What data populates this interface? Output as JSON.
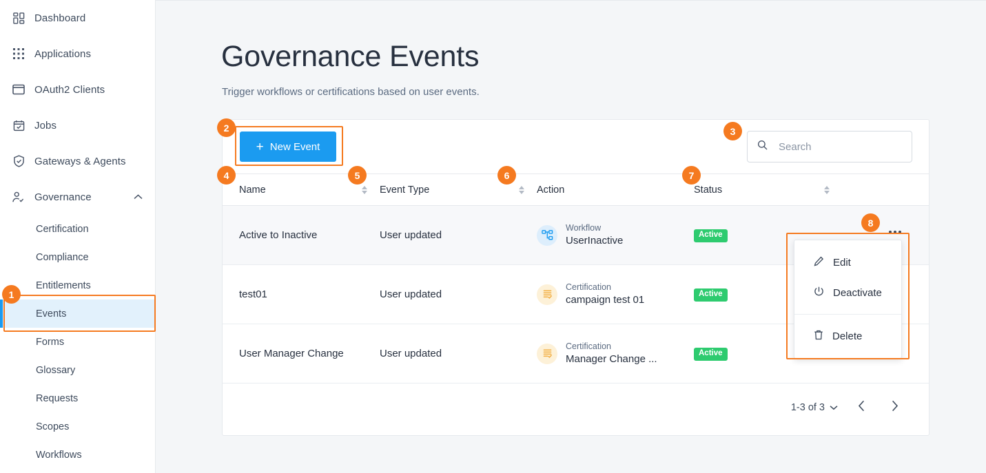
{
  "sidebar": {
    "items": [
      {
        "label": "Dashboard",
        "icon": "dashboard-icon"
      },
      {
        "label": "Applications",
        "icon": "applications-grid-icon"
      },
      {
        "label": "OAuth2 Clients",
        "icon": "window-icon"
      },
      {
        "label": "Jobs",
        "icon": "calendar-check-icon"
      },
      {
        "label": "Gateways & Agents",
        "icon": "shield-check-icon"
      },
      {
        "label": "Governance",
        "icon": "user-check-icon",
        "expanded": true,
        "caret": "chevron-up-icon"
      }
    ],
    "sub_items": [
      {
        "label": "Certification",
        "active": false
      },
      {
        "label": "Compliance",
        "active": false
      },
      {
        "label": "Entitlements",
        "active": false
      },
      {
        "label": "Events",
        "active": true
      },
      {
        "label": "Forms",
        "active": false
      },
      {
        "label": "Glossary",
        "active": false
      },
      {
        "label": "Requests",
        "active": false
      },
      {
        "label": "Scopes",
        "active": false
      },
      {
        "label": "Workflows",
        "active": false
      }
    ],
    "active_accent_color": "#1b9bf0",
    "active_bg_color": "#e2f1fc"
  },
  "header": {
    "title": "Governance Events",
    "subtitle": "Trigger workflows or certifications based on user events."
  },
  "toolbar": {
    "new_event_label": "New Event",
    "new_event_plus": "+",
    "new_event_color": "#1b9bf0",
    "search_placeholder": "Search",
    "search_value": ""
  },
  "table": {
    "columns": [
      {
        "label": "Name",
        "sortable": true
      },
      {
        "label": "Event Type",
        "sortable": true
      },
      {
        "label": "Action",
        "sortable": false
      },
      {
        "label": "Status",
        "sortable": true
      }
    ],
    "rows": [
      {
        "name": "Active to Inactive",
        "event_type": "User updated",
        "action_kind": "Workflow",
        "action_name": "UserInactive",
        "action_icon": "workflow-icon",
        "status": "Active"
      },
      {
        "name": "test01",
        "event_type": "User updated",
        "action_kind": "Certification",
        "action_name": "campaign test 01",
        "action_icon": "certification-icon",
        "status": "Active"
      },
      {
        "name": "User Manager Change",
        "event_type": "User updated",
        "action_kind": "Certification",
        "action_name": "Manager Change ...",
        "action_icon": "certification-icon",
        "status": "Active"
      }
    ],
    "status_color": "#2ecb6f"
  },
  "pagination": {
    "range_label": "1-3 of 3",
    "prev_icon": "chevron-left-icon",
    "next_icon": "chevron-right-icon",
    "dropdown_icon": "chevron-down-icon"
  },
  "row_menu": {
    "items": [
      {
        "label": "Edit",
        "icon": "pencil-icon"
      },
      {
        "label": "Deactivate",
        "icon": "power-icon"
      },
      {
        "label": "Delete",
        "icon": "trash-icon"
      }
    ]
  },
  "annotations": {
    "color": "#f57a20",
    "markers": [
      {
        "n": "1",
        "target": "sidebar-item-events"
      },
      {
        "n": "2",
        "target": "new-event-button"
      },
      {
        "n": "3",
        "target": "search-input"
      },
      {
        "n": "4",
        "target": "column-header-name"
      },
      {
        "n": "5",
        "target": "column-header-event-type"
      },
      {
        "n": "6",
        "target": "column-header-action"
      },
      {
        "n": "7",
        "target": "column-header-status"
      },
      {
        "n": "8",
        "target": "row-actions-menu"
      }
    ]
  }
}
